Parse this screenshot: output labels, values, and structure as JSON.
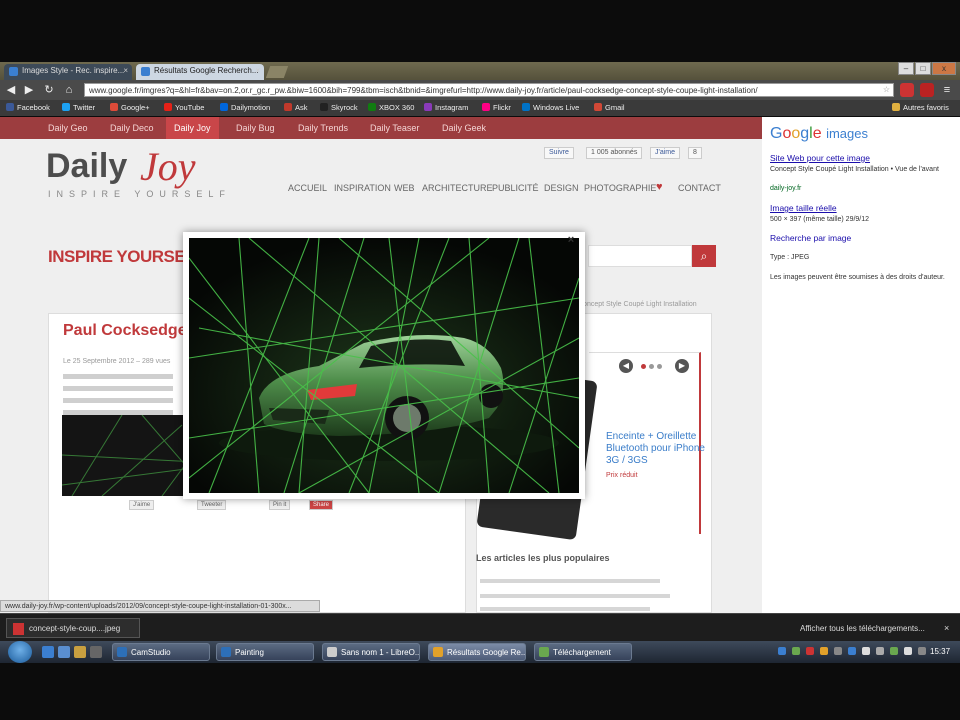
{
  "browser": {
    "tabs": [
      {
        "label": "Images Style - Rec. inspire..."
      },
      {
        "label": "Résultats Google Recherch..."
      }
    ],
    "url": "www.google.fr/imgres?q=&hl=fr&bav=on.2,or.r_gc.r_pw.&biw=1600&bih=799&tbm=isch&tbnid=&imgrefurl=http://www.daily-joy.fr/article/paul-cocksedge-concept-style-coupe-light-installation/",
    "bookmarks": [
      {
        "label": "Facebook",
        "color": "#3b5998"
      },
      {
        "label": "Twitter",
        "color": "#1da1f2"
      },
      {
        "label": "Google+",
        "color": "#dd4b39"
      },
      {
        "label": "YouTube",
        "color": "#e62117"
      },
      {
        "label": "Dailymotion",
        "color": "#0066dc"
      },
      {
        "label": "Ask",
        "color": "#c0392b"
      },
      {
        "label": "Skyrock",
        "color": "#222222"
      },
      {
        "label": "XBOX 360",
        "color": "#107c10"
      },
      {
        "label": "Instagram",
        "color": "#8a3ab9"
      },
      {
        "label": "Flickr",
        "color": "#ff0084"
      },
      {
        "label": "Windows Live",
        "color": "#0072c6"
      },
      {
        "label": "Gmail",
        "color": "#d14836"
      }
    ],
    "other_bookmarks": "Autres favoris",
    "window_controls": {
      "minimize": "–",
      "maximize": "□",
      "close": "x"
    }
  },
  "site": {
    "nav": [
      "Daily Geo",
      "Daily Deco",
      "Daily Joy",
      "Daily Bug",
      "Daily Trends",
      "Daily Teaser",
      "Daily Geek"
    ],
    "logo_daily": "Daily",
    "logo_joy": "Joy",
    "tagline": "INSPIRE YOURSELF",
    "social": {
      "twitter": "Suivre",
      "followers": "1 005 abonnés",
      "facebook": "J'aime",
      "likes": "8"
    },
    "menu": [
      "ACCUEIL",
      "INSPIRATION",
      "WEB",
      "ARCHITECTURE",
      "PUBLICITÉ",
      "DESIGN",
      "PHOTOGRAPHIE",
      "CONTACT"
    ],
    "heading": "INSPIRE YOURSELF !",
    "breadcrumb": "Concept Style Coupé Light Installation",
    "article": {
      "title": "Paul Cocksedge - Con",
      "date": "Le 25 Septembre 2012 – 289 vues",
      "share": [
        "J'aime",
        "Tweeter",
        "Pin it",
        "Share"
      ]
    },
    "sidebar": {
      "product_title": "Enceinte + Oreillette Bluetooth pour iPhone 3G / 3GS",
      "product_price": "Prix réduit",
      "popular_title": "Les articles les plus populaires"
    }
  },
  "lightbox": {
    "close": "×"
  },
  "google_panel": {
    "logo_google": "Google",
    "logo_images": "images",
    "link1": "Site Web pour cette image",
    "text1": "Concept Style Coupé Light Installation • Vue de l'avant",
    "url1": "daily-joy.fr",
    "link2": "Image taille réelle",
    "text2": "500 × 397 (même taille) 29/9/12",
    "link3": "Recherche par image",
    "type": "Type : JPEG",
    "note": "Les images peuvent être soumises à des droits d'auteur."
  },
  "status_url": "www.daily-joy.fr/wp-content/uploads/2012/09/concept-style-coupe-light-installation-01-300x...",
  "downloads": {
    "item": "concept-style-coup....jpeg",
    "show_all": "Afficher tous les téléchargements...",
    "close": "×"
  },
  "taskbar": {
    "items": [
      {
        "label": "CamStudio",
        "color": "#2d6fb8"
      },
      {
        "label": "Painting",
        "color": "#2d6fb8"
      },
      {
        "label": "Sans nom 1 - LibreO...",
        "color": "#cccccc"
      },
      {
        "label": "Résultats Google Re...",
        "color": "#e2a12a"
      },
      {
        "label": "Téléchargement",
        "color": "#6aa84f"
      }
    ],
    "clock": "15:37"
  }
}
